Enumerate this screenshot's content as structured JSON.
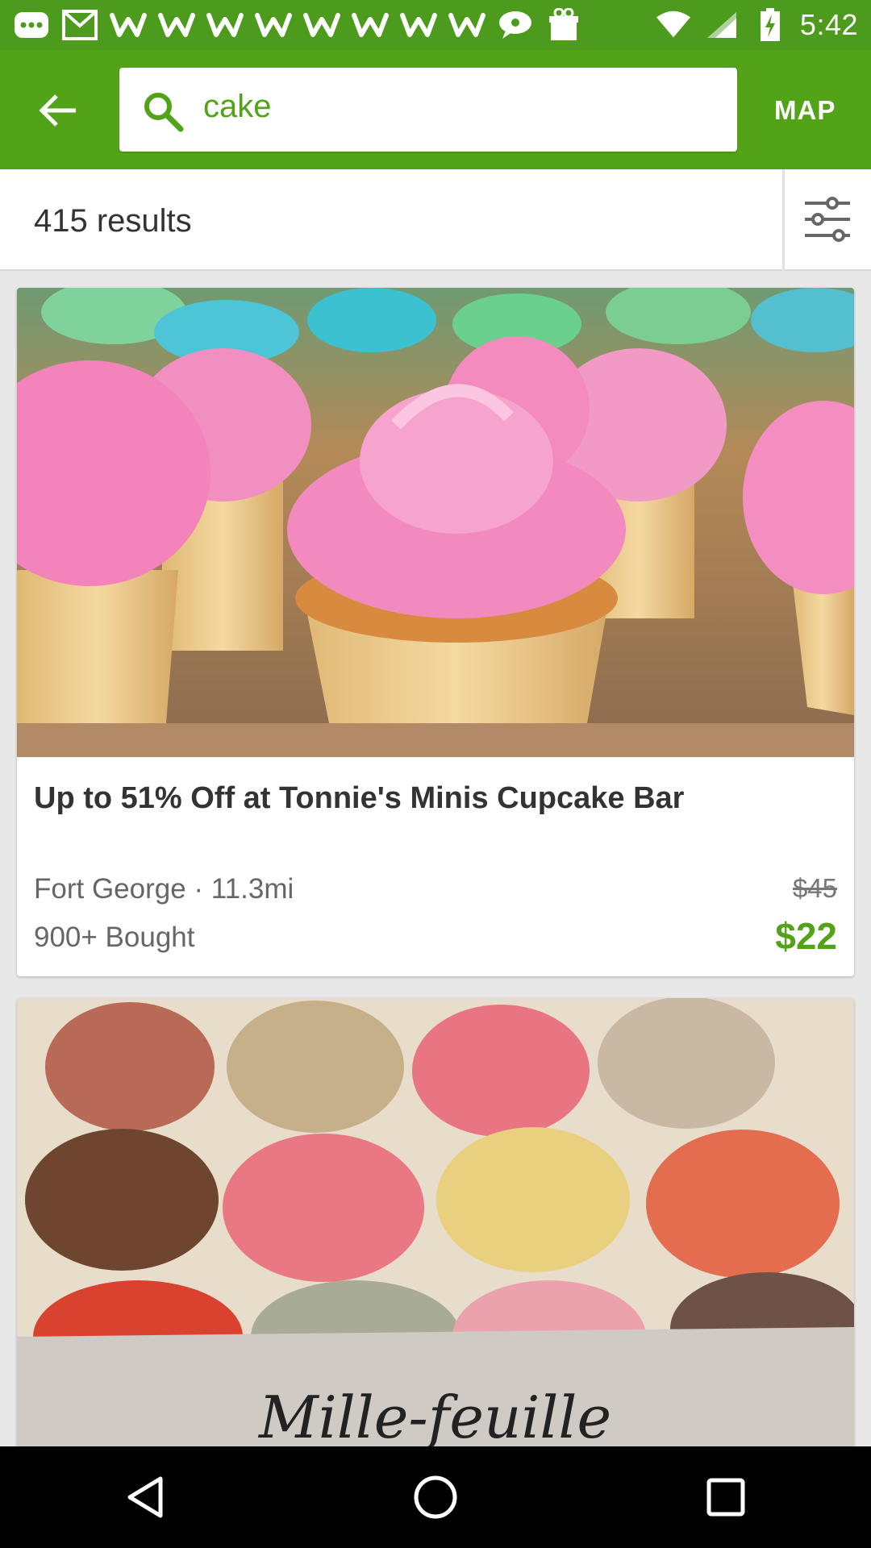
{
  "status_bar": {
    "time": "5:42",
    "icons": [
      "messenger-icon",
      "gmail-icon",
      "w-app-icon",
      "w-app-icon",
      "w-app-icon",
      "w-app-icon",
      "w-app-icon",
      "w-app-icon",
      "w-app-icon",
      "w-app-icon",
      "chat-bubble-icon",
      "gift-box-icon",
      "wifi-icon",
      "signal-icon",
      "battery-charging-icon"
    ]
  },
  "appbar": {
    "search_value": "cake",
    "map_label": "MAP",
    "accent_color": "#53a318"
  },
  "results": {
    "count_label": "415 results"
  },
  "deals": [
    {
      "title": "Up to 51% Off at Tonnie's Minis Cupcake Bar",
      "location": "Fort George · 11.3mi",
      "bought": "900+ Bought",
      "original_price": "$45",
      "price": "$22",
      "image": "pink-cupcakes-photo"
    },
    {
      "image": "macarons-box-photo",
      "image_text": "Mille-feuille"
    }
  ],
  "navbar": {
    "icons": [
      "back-triangle-icon",
      "home-circle-icon",
      "recents-square-icon"
    ]
  }
}
